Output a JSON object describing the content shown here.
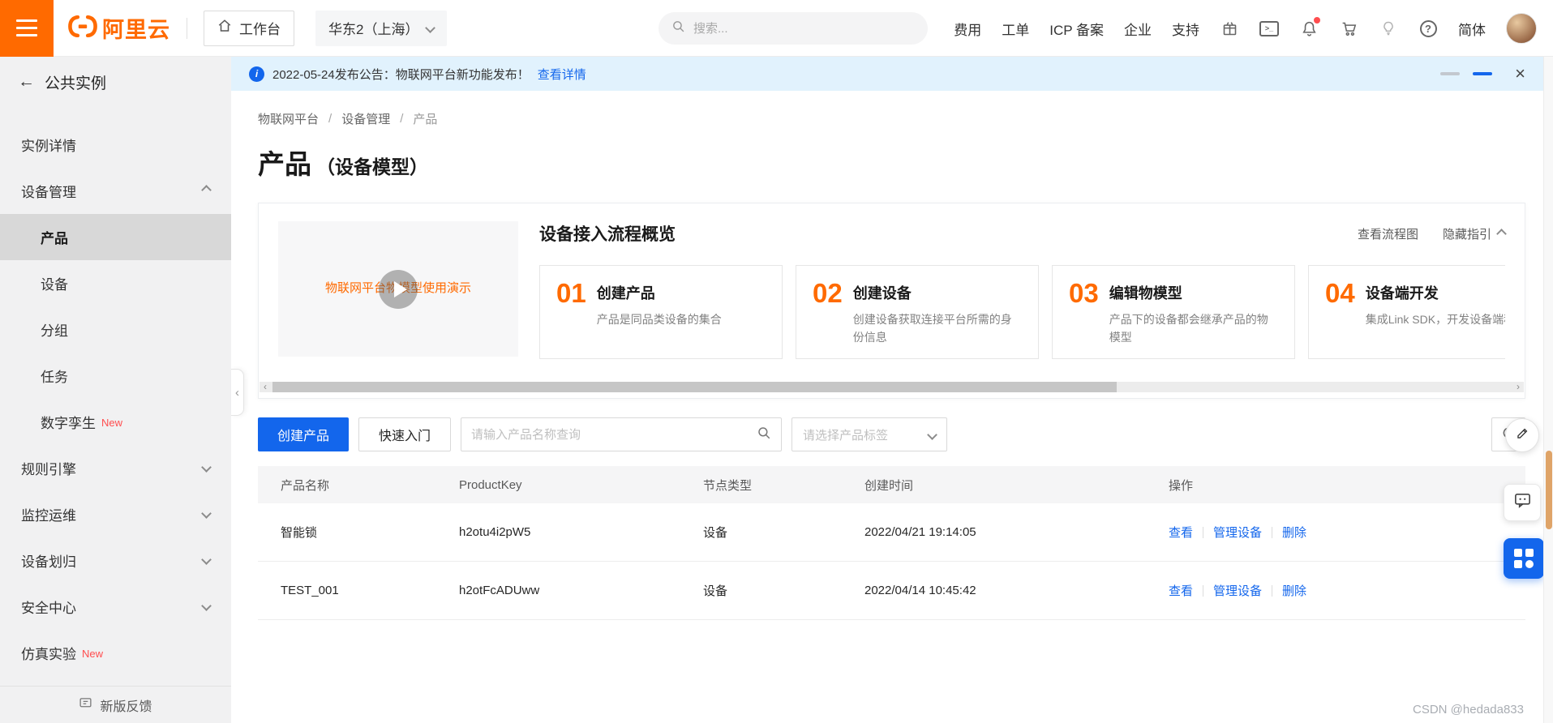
{
  "topnav": {
    "logo_text": "阿里云",
    "workbench": "工作台",
    "region": "华东2（上海）",
    "search_placeholder": "搜索...",
    "links": [
      {
        "label": "费用"
      },
      {
        "label": "工单"
      },
      {
        "label": "ICP 备案"
      },
      {
        "label": "企业"
      },
      {
        "label": "支持"
      }
    ],
    "lang": "简体"
  },
  "icons": {
    "back": "←",
    "close": "×",
    "help": "?",
    "terminal": ">_",
    "info": "i",
    "collapse": "‹",
    "scroll_left": "‹",
    "scroll_right": "›",
    "separator": "/"
  },
  "sidebar": {
    "back_label": "公共实例",
    "items": [
      {
        "label": "实例详情"
      },
      {
        "label": "设备管理"
      },
      {
        "label": "产品"
      },
      {
        "label": "设备"
      },
      {
        "label": "分组"
      },
      {
        "label": "任务"
      },
      {
        "label": "数字孪生",
        "badge": "New"
      },
      {
        "label": "规则引擎"
      },
      {
        "label": "监控运维"
      },
      {
        "label": "设备划归"
      },
      {
        "label": "安全中心"
      },
      {
        "label": "仿真实验",
        "badge": "New"
      }
    ],
    "feedback": "新版反馈"
  },
  "banner": {
    "text": "2022-05-24发布公告：物联网平台新功能发布！",
    "link": "查看详情"
  },
  "breadcrumb": [
    "物联网平台",
    "设备管理",
    "产品"
  ],
  "page": {
    "title": "产品",
    "subtitle": "（设备模型）"
  },
  "guide": {
    "video_caption": "物联网平台物模型使用演示",
    "title": "设备接入流程概览",
    "flowchart_link": "查看流程图",
    "hide_link": "隐藏指引",
    "steps": [
      {
        "num": "01",
        "title": "创建产品",
        "desc": "产品是同品类设备的集合"
      },
      {
        "num": "02",
        "title": "创建设备",
        "desc": "创建设备获取连接平台所需的身份信息"
      },
      {
        "num": "03",
        "title": "编辑物模型",
        "desc": "产品下的设备都会继承产品的物模型"
      },
      {
        "num": "04",
        "title": "设备端开发",
        "desc": "集成Link SDK，开发设备端程序"
      }
    ]
  },
  "toolbar": {
    "create_button": "创建产品",
    "quickstart_button": "快速入门",
    "search_placeholder": "请输入产品名称查询",
    "tag_select_placeholder": "请选择产品标签"
  },
  "table": {
    "headers": [
      "产品名称",
      "ProductKey",
      "节点类型",
      "创建时间",
      "操作"
    ],
    "rows": [
      {
        "name": "智能锁",
        "product_key": "h2otu4i2pW5",
        "node_type": "设备",
        "created": "2022/04/21 19:14:05"
      },
      {
        "name": "TEST_001",
        "product_key": "h2otFcADUww",
        "node_type": "设备",
        "created": "2022/04/14 10:45:42"
      }
    ],
    "actions": [
      "查看",
      "管理设备",
      "删除"
    ]
  },
  "watermark": "CSDN @hedada833",
  "colors": {
    "brand_orange": "#ff6a00",
    "primary_blue": "#1366ec",
    "banner_bg": "#e1f2fd",
    "badge_red": "#ff4d4f",
    "sidebar_bg": "#f1f1f2",
    "active_item_bg": "#d8d8d8"
  }
}
